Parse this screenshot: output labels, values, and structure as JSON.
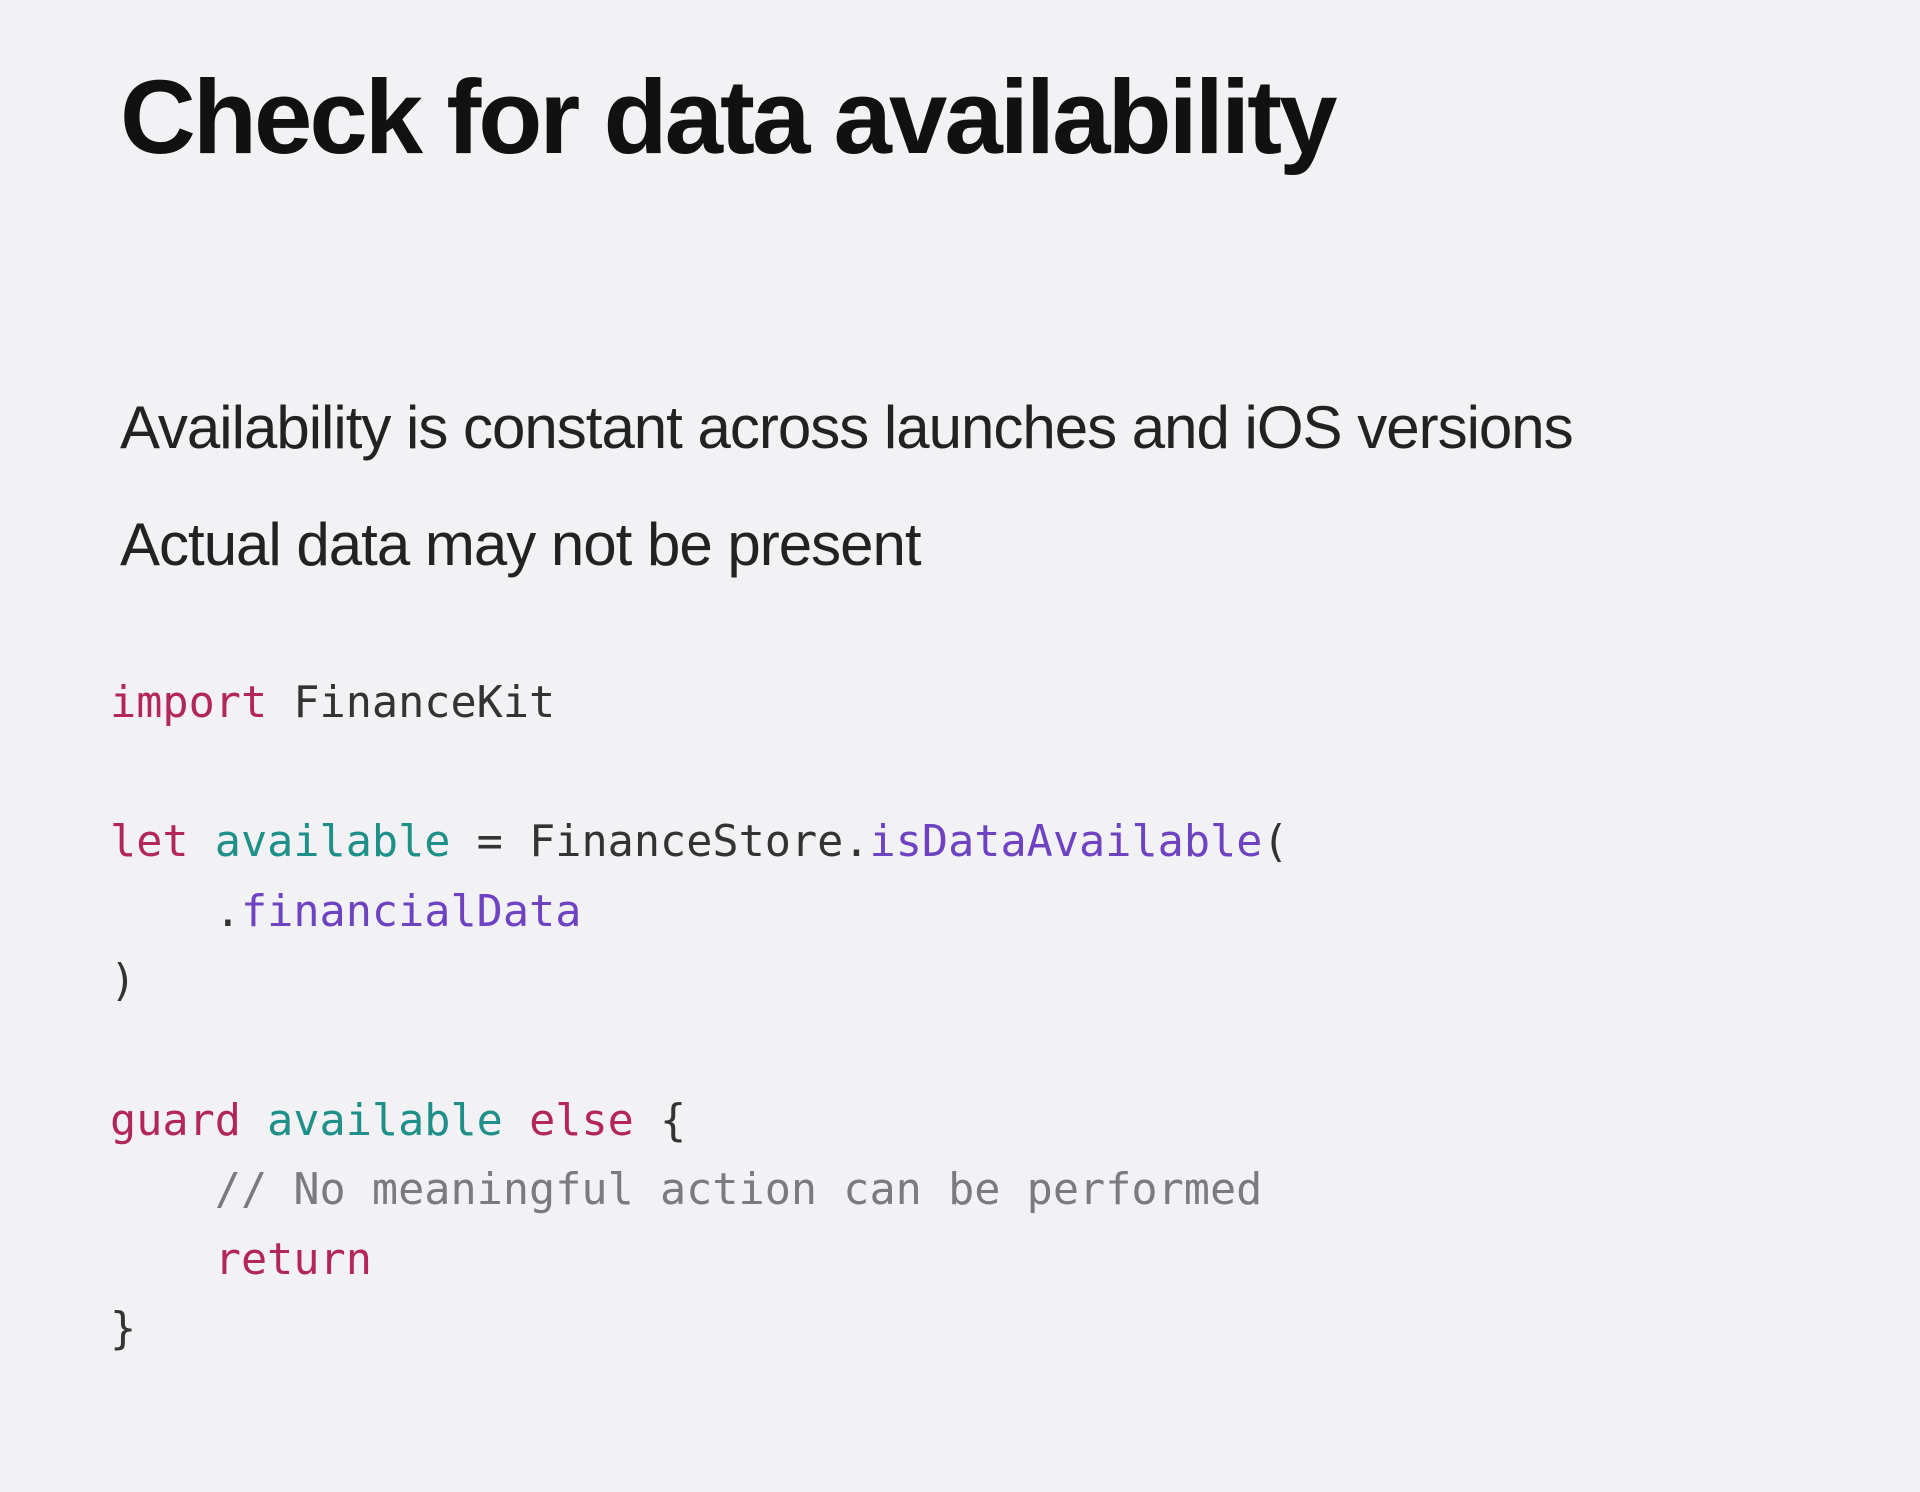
{
  "slide": {
    "title": "Check for data availability",
    "bullets": [
      "Availability is constant across launches and iOS versions",
      "Actual data may not be present"
    ],
    "code": {
      "line1": {
        "kw": "import",
        "rest": " FinanceKit"
      },
      "line2": "",
      "line3": {
        "kw": "let",
        "var": " available",
        "eq": " = ",
        "type": "FinanceStore",
        "dot": ".",
        "fn": "isDataAvailable",
        "open": "("
      },
      "line4": {
        "indent": "    ",
        "dot": ".",
        "case": "financialData"
      },
      "line5": ")",
      "line6": "",
      "line7": {
        "kw1": "guard",
        "var": " available",
        "sp": " ",
        "kw2": "else",
        "brace": " {"
      },
      "line8": {
        "indent": "    ",
        "comment": "// No meaningful action can be performed"
      },
      "line9": {
        "indent": "    ",
        "kw": "return"
      },
      "line10": "}"
    }
  }
}
